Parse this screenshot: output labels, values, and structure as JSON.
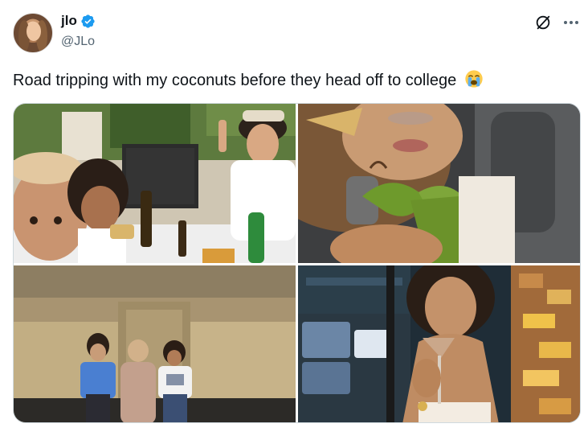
{
  "author": {
    "display_name": "jlo",
    "handle": "@JLo",
    "verified": true,
    "verified_color": "#1d9bf0"
  },
  "tweet": {
    "text": "Road tripping with my coconuts before they head off to college",
    "emoji": "crying-face-emoji"
  },
  "actions": {
    "grok_icon": "slash-circle-icon",
    "more_icon": "more-horizontal-icon"
  },
  "media": {
    "count": 4,
    "photos": [
      {
        "name": "photo-selfie-restaurant"
      },
      {
        "name": "photo-sunbathing-scarf"
      },
      {
        "name": "photo-three-in-courtyard"
      },
      {
        "name": "photo-drinking-cocktail"
      }
    ]
  },
  "colors": {
    "text_primary": "#0f1419",
    "text_secondary": "#536471",
    "border": "#cfd9de"
  }
}
